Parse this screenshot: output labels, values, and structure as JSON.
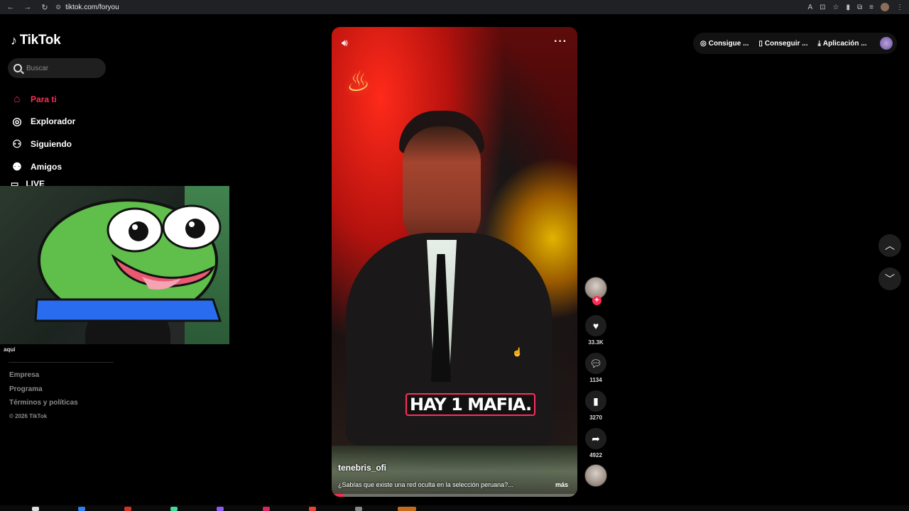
{
  "browser": {
    "url": "tiktok.com/foryou",
    "back_icon": "back-arrow-icon",
    "forward_icon": "forward-arrow-icon",
    "reload_icon": "reload-icon"
  },
  "sidebar": {
    "logo_text": "TikTok",
    "search_placeholder": "Buscar",
    "items": [
      {
        "label": "Para ti",
        "icon": "home-icon",
        "active": true
      },
      {
        "label": "Explorador",
        "icon": "compass-icon",
        "active": false
      },
      {
        "label": "Siguiendo",
        "icon": "user-follow-icon",
        "active": false
      },
      {
        "label": "Amigos",
        "icon": "friends-icon",
        "active": false
      },
      {
        "label": "LIVE",
        "icon": "live-icon",
        "active": false
      }
    ],
    "webcam_caption": "aquí",
    "footer": {
      "company": "Empresa",
      "program": "Programa",
      "terms": "Términos y políticas",
      "copyright": "© 2026 TikTok"
    }
  },
  "video": {
    "overlay_text": "HAY 1 MAFIA.",
    "username": "tenebris_ofi",
    "description": "¿Sabías que existe una red oculta en la selección peruana?...",
    "more_label": "más",
    "progress_fraction": 0.05
  },
  "actions": {
    "likes": "33.3K",
    "comments": "1134",
    "saves": "3270",
    "shares": "4922"
  },
  "top_bar": {
    "coins_label": "Consigue ...",
    "app_label": "Conseguir ...",
    "download_label": "Aplicación ..."
  },
  "colors": {
    "accent": "#fe2c55",
    "background": "#000000"
  }
}
